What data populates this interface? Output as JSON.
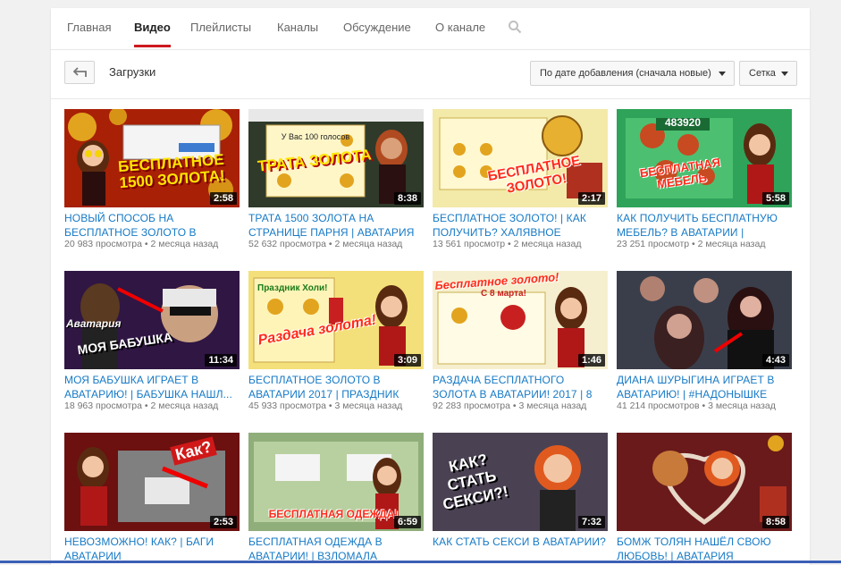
{
  "tabs": [
    {
      "label": "Главная"
    },
    {
      "label": "Видео"
    },
    {
      "label": "Плейлисты"
    },
    {
      "label": "Каналы"
    },
    {
      "label": "Обсуждение"
    },
    {
      "label": "О канале"
    }
  ],
  "toolbar": {
    "title": "Загрузки",
    "sort_label": "По дате добавления (сначала новые)",
    "view_label": "Сетка"
  },
  "colors": {
    "link": "#167ac6",
    "active_tab_underline": "#cc181e",
    "meta": "#767676"
  },
  "videos": [
    {
      "title": "НОВЫЙ СПОСОБ НА БЕСПЛАТНОЕ ЗОЛОТО В",
      "views": "20 983 просмотра",
      "age": "2 месяца назад",
      "duration": "2:58",
      "thumb_text": "БЕСПЛАТНОЕ 1500 ЗОЛОТА!"
    },
    {
      "title": "ТРАТА 1500 ЗОЛОТА НА СТРАНИЦЕ ПАРНЯ | АВАТАРИЯ",
      "views": "52 632 просмотра",
      "age": "2 месяца назад",
      "duration": "8:38",
      "thumb_text": "ТРАТА ЗОЛОТА"
    },
    {
      "title": "БЕСПЛАТНОЕ ЗОЛОТО! | КАК ПОЛУЧИТЬ? ХАЛЯВНОЕ",
      "views": "13 561 просмотр",
      "age": "2 месяца назад",
      "duration": "2:17",
      "thumb_text": "БЕСПЛАТНОЕ ЗОЛОТО!"
    },
    {
      "title": "КАК ПОЛУЧИТЬ БЕСПЛАТНУЮ МЕБЕЛЬ? В АВАТАРИИ |",
      "views": "23 251 просмотр",
      "age": "2 месяца назад",
      "duration": "5:58",
      "thumb_text": "БЕСПЛАТНАЯ МЕБЕЛЬ"
    },
    {
      "title": "МОЯ БАБУШКА ИГРАЕТ В АВАТАРИЮ! | БАБУШКА НАШЛ...",
      "views": "18 963 просмотра",
      "age": "2 месяца назад",
      "duration": "11:34",
      "thumb_text": "МОЯ БАБУШКА"
    },
    {
      "title": "БЕСПЛАТНОЕ ЗОЛОТО В АВАТАРИИ 2017 | ПРАЗДНИК",
      "views": "45 933 просмотра",
      "age": "3 месяца назад",
      "duration": "3:09",
      "thumb_text": "Раздача золота!"
    },
    {
      "title": "РАЗДАЧА БЕСПЛАТНОГО ЗОЛОТА В АВАТАРИИ! 2017 | 8",
      "views": "92 283 просмотра",
      "age": "3 месяца назад",
      "duration": "1:46",
      "thumb_text": "Бесплатное золото!"
    },
    {
      "title": "ДИАНА ШУРЫГИНА ИГРАЕТ В АВАТАРИЮ! | #НАДОНЫШКЕ",
      "views": "41 214 просмотров",
      "age": "3 месяца назад",
      "duration": "4:43",
      "thumb_text": ""
    },
    {
      "title": "НЕВОЗМОЖНО! КАК? | БАГИ АВАТАРИИ",
      "views": "",
      "age": "",
      "duration": "2:53",
      "thumb_text": "Как?"
    },
    {
      "title": "БЕСПЛАТНАЯ ОДЕЖДА В АВАТАРИИ! | ВЗЛОМАЛА",
      "views": "",
      "age": "",
      "duration": "6:59",
      "thumb_text": "БЕСПЛАТНАЯ ОДЕЖДА!"
    },
    {
      "title": "КАК СТАТЬ СЕКСИ В АВАТАРИИ?",
      "views": "",
      "age": "",
      "duration": "7:32",
      "thumb_text": "КАК? СТАТЬ СЕКСИ?!"
    },
    {
      "title": "БОМЖ ТОЛЯН НАШЁЛ СВОЮ ЛЮБОВЬ! | АВАТАРИЯ",
      "views": "",
      "age": "",
      "duration": "8:58",
      "thumb_text": ""
    }
  ]
}
